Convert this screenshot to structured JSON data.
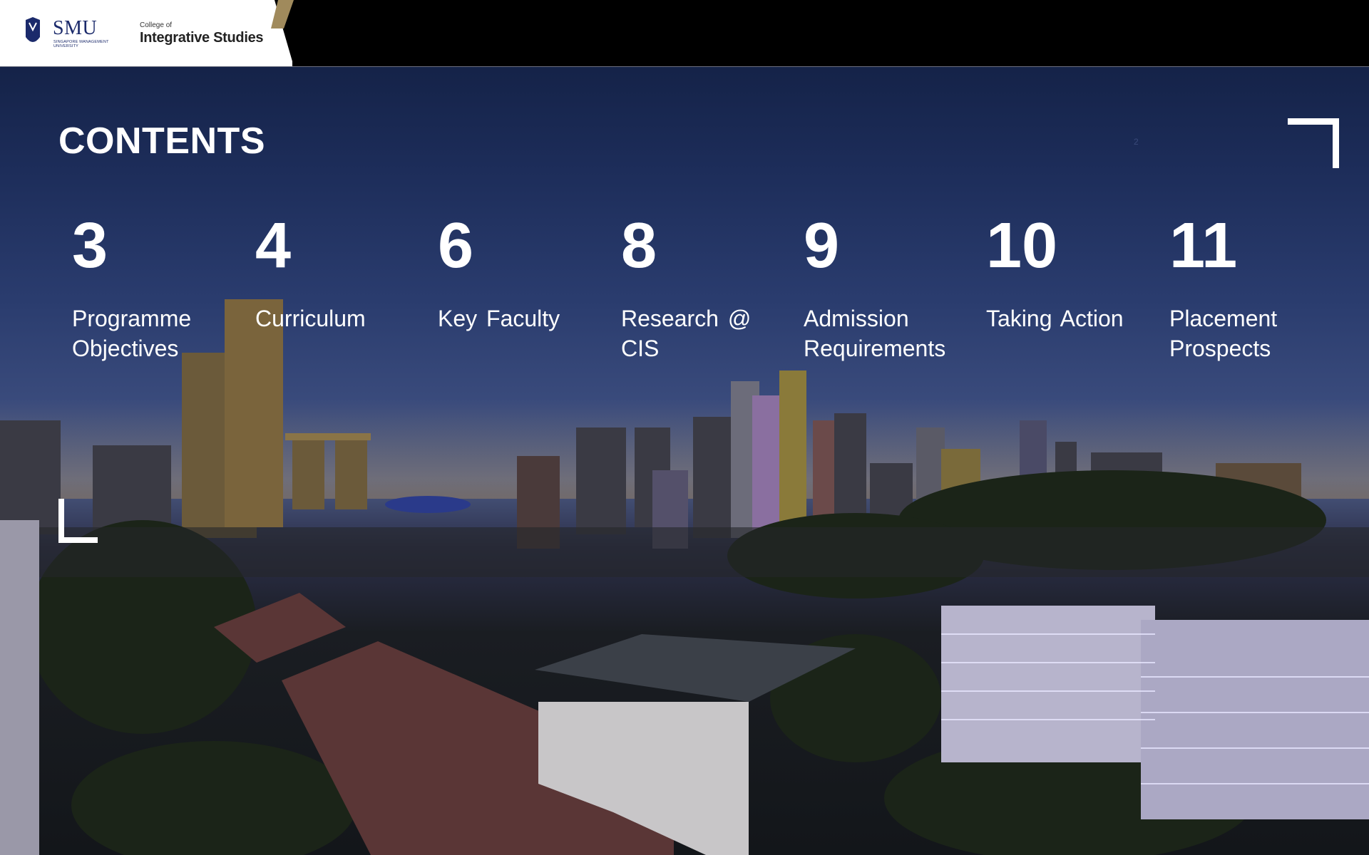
{
  "header": {
    "logo_primary": "SMU",
    "logo_subtitle": "SINGAPORE MANAGEMENT UNIVERSITY",
    "college_prefix": "College of",
    "college_name": "Integrative Studies"
  },
  "slide": {
    "title": "CONTENTS",
    "page_number": "2"
  },
  "contents": [
    {
      "page": "3",
      "label": "Programme Objectives"
    },
    {
      "page": "4",
      "label": "Curriculum"
    },
    {
      "page": "6",
      "label": "Key Faculty"
    },
    {
      "page": "8",
      "label": "Research @ CIS"
    },
    {
      "page": "9",
      "label": "Admission Requirements"
    },
    {
      "page": "10",
      "label": "Taking Action"
    },
    {
      "page": "11",
      "label": "Placement Prospects"
    }
  ],
  "colors": {
    "header_bg": "#000000",
    "accent_gold": "#a08a5c",
    "smu_blue": "#1b2a6b",
    "text": "#ffffff"
  }
}
